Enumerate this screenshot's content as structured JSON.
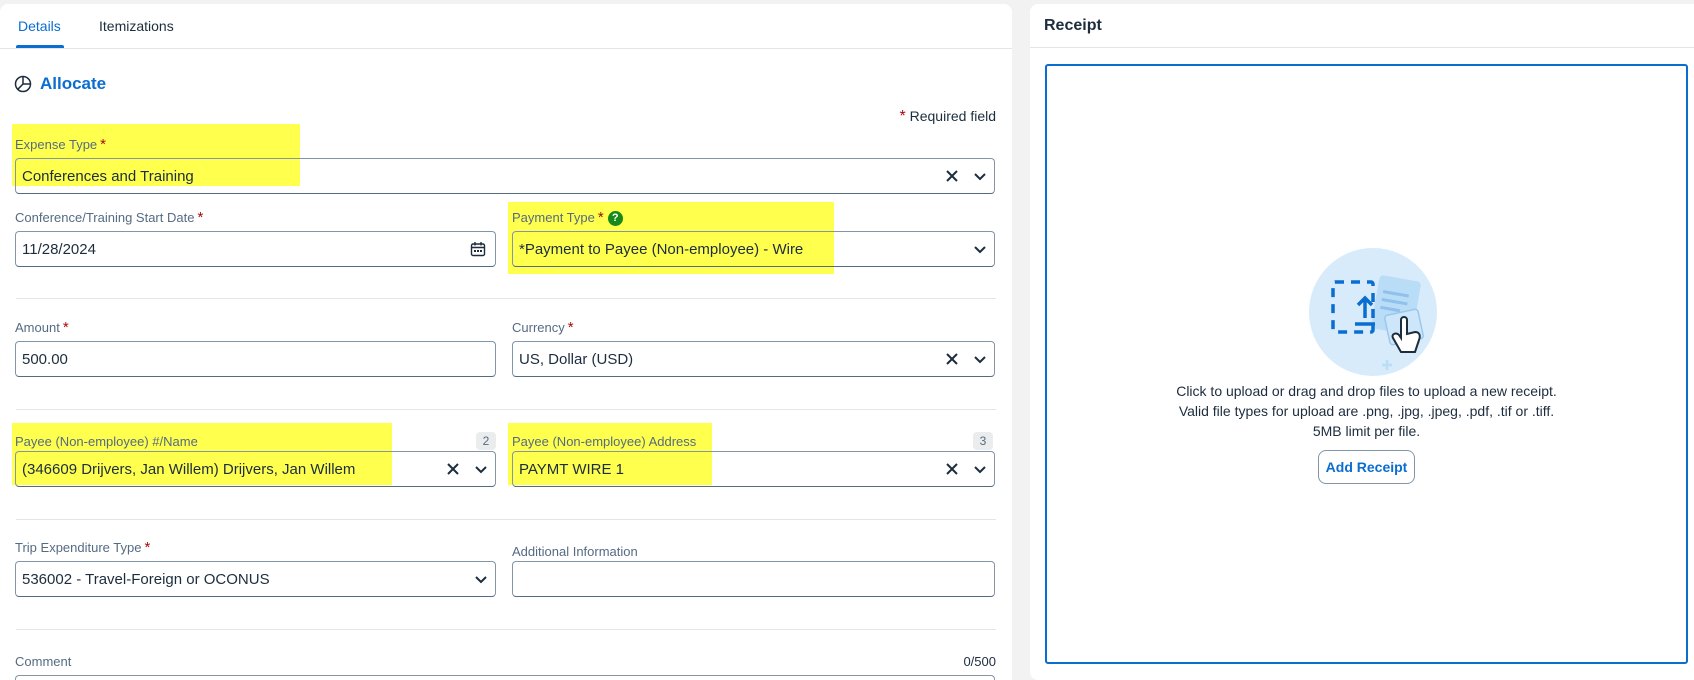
{
  "tabs": [
    {
      "label": "Details",
      "active": true
    },
    {
      "label": "Itemizations",
      "active": false
    }
  ],
  "allocate": {
    "label": "Allocate"
  },
  "required_note": {
    "star": "*",
    "text": "Required field"
  },
  "fields": {
    "expense_type": {
      "label": "Expense Type",
      "required": "*",
      "value": "Conferences and Training"
    },
    "start_date": {
      "label": "Conference/Training Start Date",
      "required": "*",
      "value": "11/28/2024"
    },
    "payment_type": {
      "label": "Payment Type",
      "required": "*",
      "help": "?",
      "value": "*Payment to Payee (Non-employee) - Wire"
    },
    "amount": {
      "label": "Amount",
      "required": "*",
      "value": "500.00"
    },
    "currency": {
      "label": "Currency",
      "required": "*",
      "value": "US, Dollar (USD)"
    },
    "payee_name": {
      "label": "Payee (Non-employee) #/Name",
      "count": "2",
      "value": "(346609 Drijvers, Jan Willem) Drijvers, Jan Willem"
    },
    "payee_address": {
      "label": "Payee (Non-employee) Address",
      "count": "3",
      "value": "PAYMT WIRE 1"
    },
    "trip_expenditure": {
      "label": "Trip Expenditure Type",
      "required": "*",
      "value": "536002 - Travel-Foreign or OCONUS"
    },
    "additional_info": {
      "label": "Additional Information",
      "value": ""
    },
    "comment": {
      "label": "Comment",
      "counter": "0/500"
    }
  },
  "receipt": {
    "title": "Receipt",
    "line1": "Click to upload or drag and drop files to upload a new receipt.",
    "line2": "Valid file types for upload are .png, .jpg, .jpeg, .pdf, .tif or .tiff.",
    "line3": "5MB limit per file.",
    "add_button": "Add Receipt"
  },
  "colors": {
    "accent": "#0a6ed1",
    "highlight": "#ffff4d",
    "required": "#aa0808",
    "help": "#188918"
  }
}
